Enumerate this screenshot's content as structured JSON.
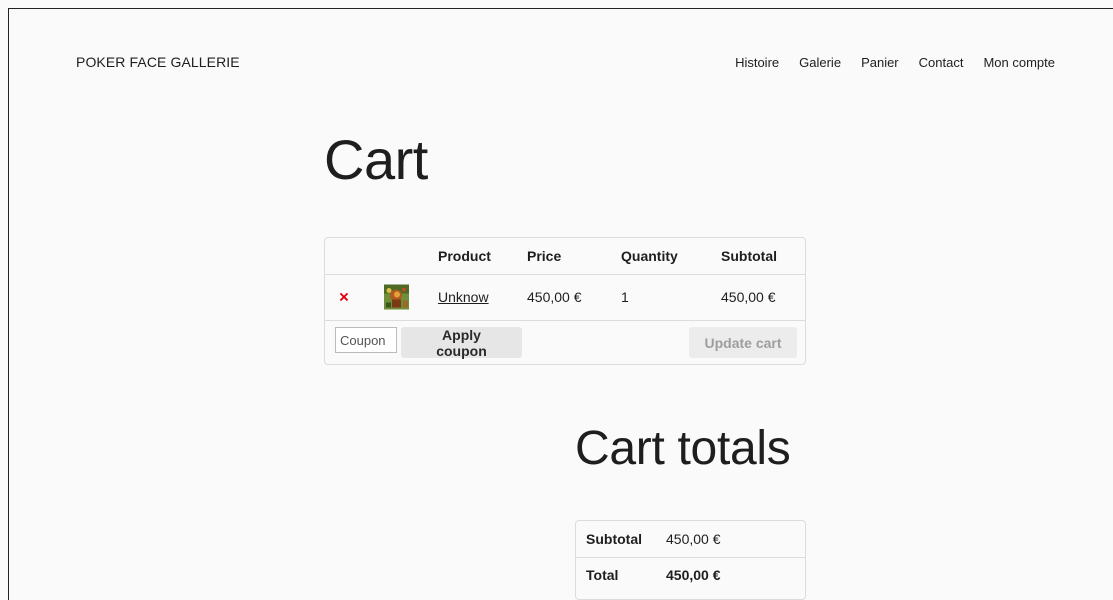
{
  "header": {
    "site_title": "POKER FACE GALLERIE",
    "nav": [
      "Histoire",
      "Galerie",
      "Panier",
      "Contact",
      "Mon compte"
    ]
  },
  "page": {
    "title": "Cart"
  },
  "cart": {
    "columns": [
      "Product",
      "Price",
      "Quantity",
      "Subtotal"
    ],
    "items": [
      {
        "remove_symbol": "×",
        "thumbnail": "artwork-thumbnail",
        "product": "Unknow",
        "price": "450,00 €",
        "quantity": "1",
        "subtotal": "450,00 €"
      }
    ],
    "coupon_placeholder": "Coupon",
    "apply_coupon_label": "Apply coupon",
    "update_cart_label": "Update cart"
  },
  "totals": {
    "title": "Cart totals",
    "rows": [
      {
        "label": "Subtotal",
        "value": "450,00 €"
      },
      {
        "label": "Total",
        "value": "450,00 €"
      }
    ]
  },
  "colors": {
    "background": "#fafafa",
    "remove_icon": "#e2000c",
    "button_bg": "#e6e6e6",
    "disabled_button_text": "#9e9e9e",
    "border": "#dcdcdc"
  },
  "icons": {
    "remove": "close-icon"
  }
}
